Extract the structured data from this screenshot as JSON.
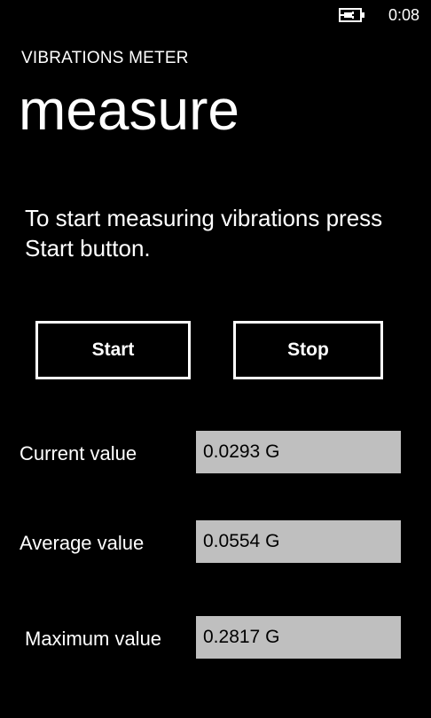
{
  "status_bar": {
    "battery_icon": "battery-charging-icon",
    "time": "0:08"
  },
  "header": {
    "app_title": "VIBRATIONS METER",
    "page_title": "measure"
  },
  "main": {
    "instructions": "To start measuring vibrations press Start button.",
    "start_label": "Start",
    "stop_label": "Stop",
    "readings": {
      "current": {
        "label": "Current value",
        "value": "0.0293 G"
      },
      "average": {
        "label": "Average value",
        "value": "0.0554 G"
      },
      "maximum": {
        "label": "Maximum value",
        "value": "0.2817 G"
      }
    }
  },
  "colors": {
    "background": "#000000",
    "foreground": "#ffffff",
    "value_box": "#bfbfbf"
  }
}
